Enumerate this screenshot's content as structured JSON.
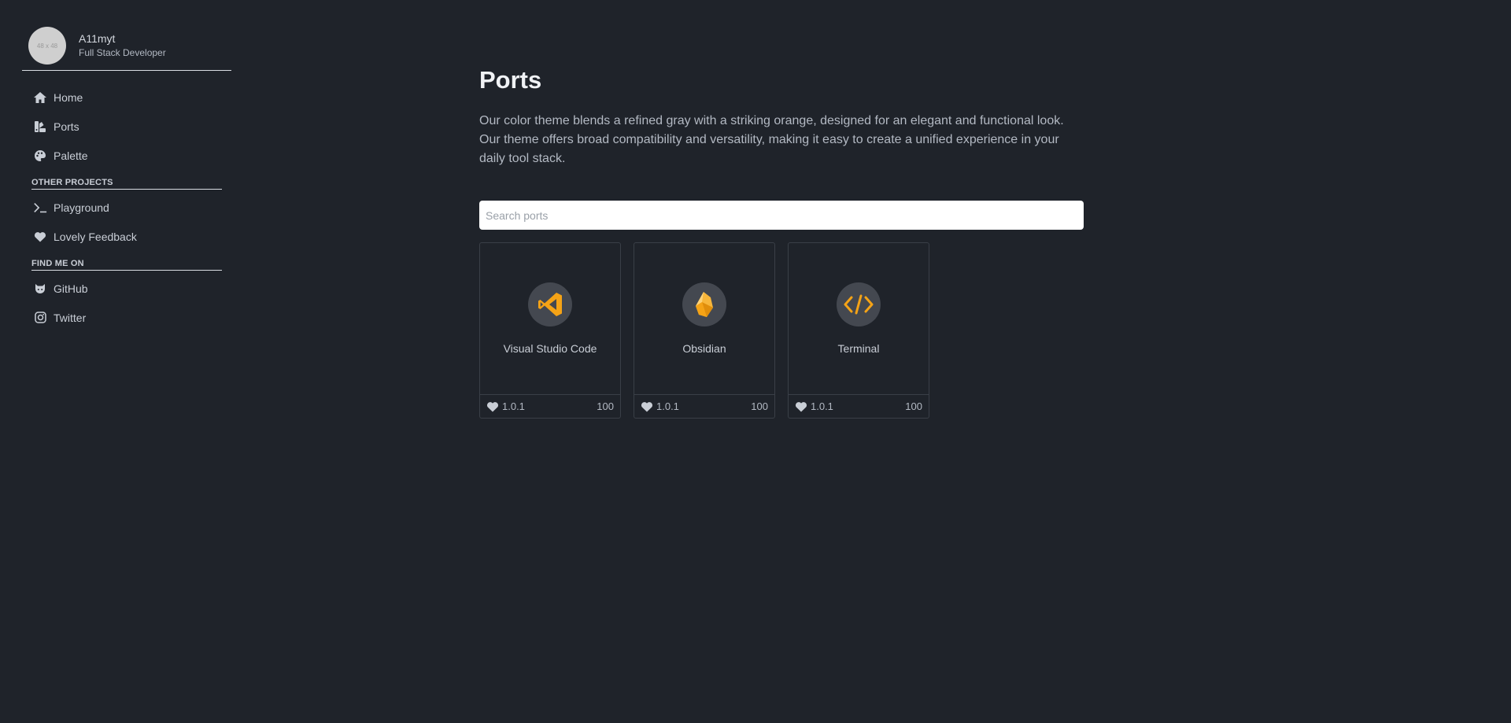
{
  "profile": {
    "avatar_text": "48 x 48",
    "name": "A11myt",
    "role": "Full Stack Developer"
  },
  "nav": {
    "home": "Home",
    "ports": "Ports",
    "palette": "Palette"
  },
  "other_projects": {
    "title": "OTHER PROJECTS",
    "playground": "Playground",
    "feedback": "Lovely Feedback"
  },
  "find_me": {
    "title": "FIND ME ON",
    "github": "GitHub",
    "twitter": "Twitter"
  },
  "main": {
    "title": "Ports",
    "description": "Our color theme blends a refined gray with a striking orange, designed for an elegant and functional look. Our theme offers broad compatibility and versatility, making it easy to create a unified experience in your daily tool stack.",
    "search_placeholder": "Search ports"
  },
  "ports": [
    {
      "name": "Visual Studio Code",
      "icon": "vscode-icon",
      "version": "1.0.1",
      "likes": "100"
    },
    {
      "name": "Obsidian",
      "icon": "obsidian-icon",
      "version": "1.0.1",
      "likes": "100"
    },
    {
      "name": "Terminal",
      "icon": "code-icon",
      "version": "1.0.1",
      "likes": "100"
    }
  ],
  "colors": {
    "background": "#1f232a",
    "accent": "#f5a316",
    "icon_circle": "#444850",
    "border": "#3a3f47"
  }
}
